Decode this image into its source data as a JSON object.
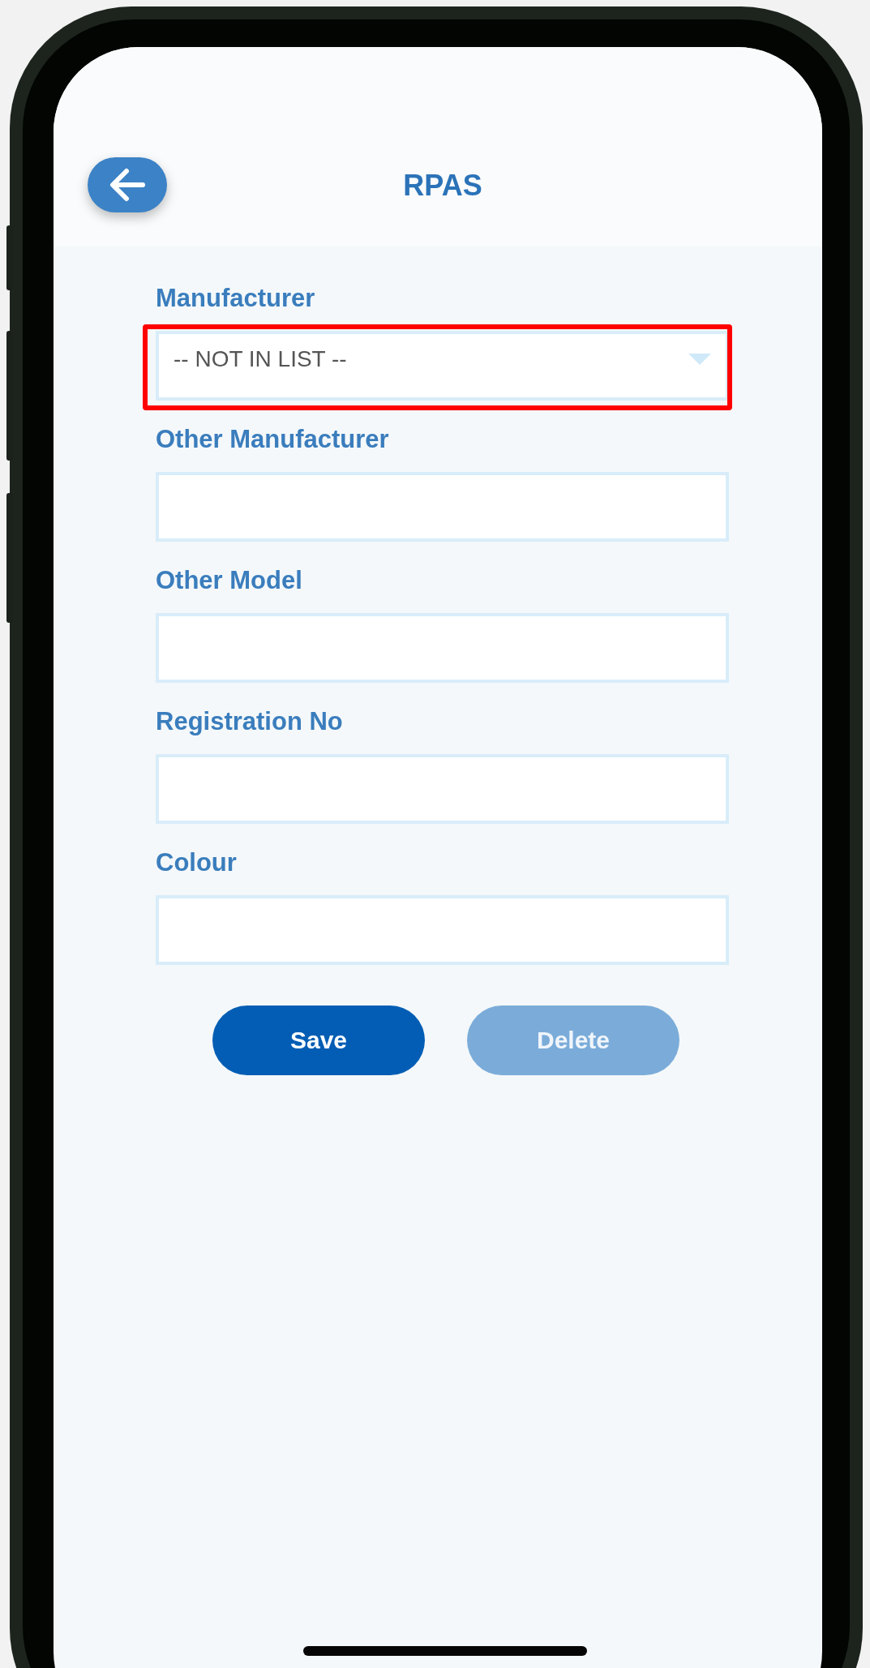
{
  "header": {
    "title": "RPAS"
  },
  "fields": [
    {
      "label": "Manufacturer",
      "kind": "select",
      "value": "-- NOT IN LIST --",
      "highlighted": true
    },
    {
      "label": "Other Manufacturer",
      "kind": "text",
      "highlighted": false
    },
    {
      "label": "Other Model",
      "kind": "text",
      "highlighted": false
    },
    {
      "label": "Registration No",
      "kind": "text",
      "highlighted": false
    },
    {
      "label": "Colour",
      "kind": "text",
      "highlighted": false
    }
  ],
  "buttons": [
    {
      "label": "Save",
      "disabled": false
    },
    {
      "label": "Delete",
      "disabled": true
    }
  ]
}
